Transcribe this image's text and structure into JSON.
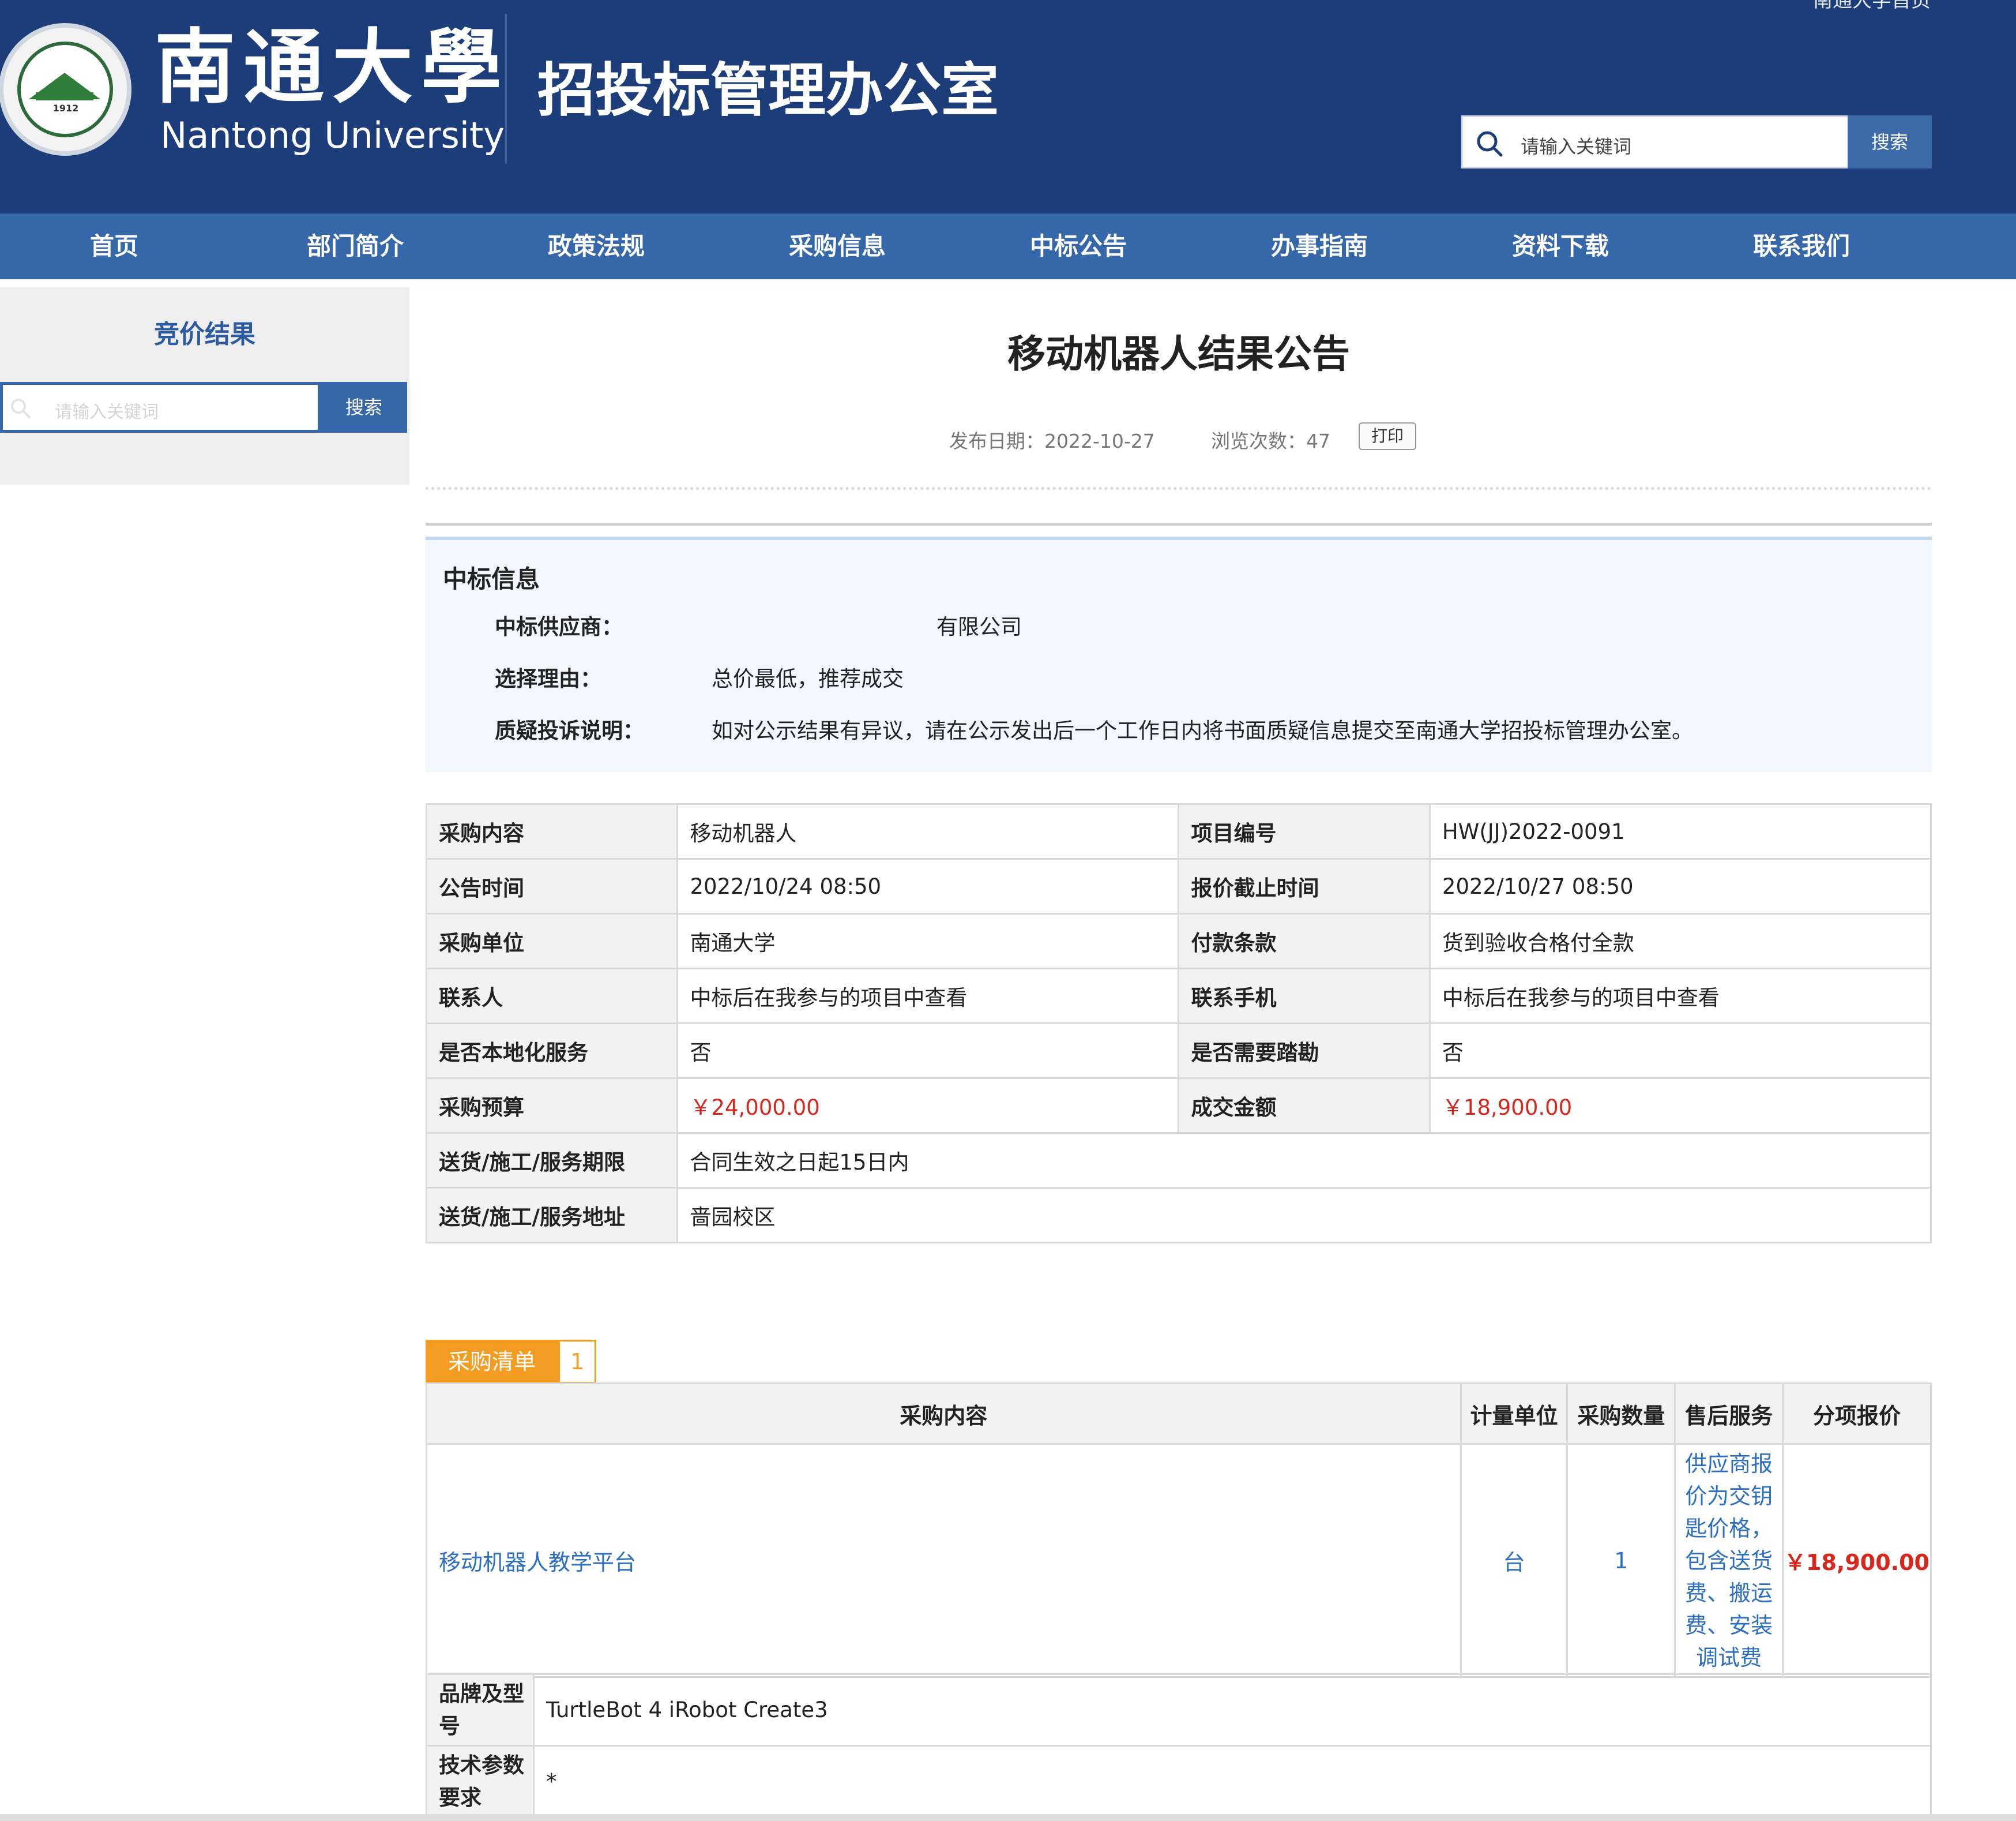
{
  "header": {
    "home_link": "南通大学首页",
    "brand_cn": "南通大學",
    "brand_en": "Nantong University",
    "seal_year": "1912",
    "office_title": "招投标管理办公室",
    "search_placeholder": "请输入关键词",
    "search_button": "搜索",
    "colors": {
      "header_bg": "#1c3d7a",
      "nav_bg": "#3567a9"
    }
  },
  "nav": {
    "items": [
      "首页",
      "部门简介",
      "政策法规",
      "采购信息",
      "中标公告",
      "办事指南",
      "资料下载",
      "联系我们"
    ]
  },
  "sidebar": {
    "title": "竞价结果",
    "search_placeholder": "请输入关键词",
    "search_button": "搜索"
  },
  "article": {
    "title": "移动机器人结果公告",
    "publish_date": "发布日期：2022-10-27",
    "views": "浏览次数：47",
    "print_button": "打印"
  },
  "bid_info": {
    "heading": "中标信息",
    "rows": [
      {
        "label": "中标供应商：",
        "value": "有限公司"
      },
      {
        "label": "选择理由：",
        "value": "总价最低，推荐成交"
      },
      {
        "label": "质疑投诉说明：",
        "value": "如对公示结果有异议，请在公示发出后一个工作日内将书面质疑信息提交至南通大学招投标管理办公室。"
      }
    ]
  },
  "details": {
    "rows": [
      {
        "k1": "采购内容",
        "v1": "移动机器人",
        "k2": "项目编号",
        "v2": "HW(JJ)2022-0091"
      },
      {
        "k1": "公告时间",
        "v1": "2022/10/24 08:50",
        "k2": "报价截止时间",
        "v2": "2022/10/27 08:50"
      },
      {
        "k1": "采购单位",
        "v1": "南通大学",
        "k2": "付款条款",
        "v2": "货到验收合格付全款"
      },
      {
        "k1": "联系人",
        "v1": "中标后在我参与的项目中查看",
        "k2": "联系手机",
        "v2": "中标后在我参与的项目中查看"
      },
      {
        "k1": "是否本地化服务",
        "v1": "否",
        "k2": "是否需要踏勘",
        "v2": "否"
      },
      {
        "k1": "采购预算",
        "v1": "￥24,000.00",
        "k2": "成交金额",
        "v2": "￥18,900.00"
      }
    ],
    "wide_rows": [
      {
        "k": "送货/施工/服务期限",
        "v": "合同生效之日起15日内"
      },
      {
        "k": "送货/施工/服务地址",
        "v": "啬园校区"
      }
    ],
    "highlight_color": "#d9261c"
  },
  "purchase_list": {
    "tab_label": "采购清单",
    "tab_count": "1",
    "headers": [
      "采购内容",
      "计量单位",
      "采购数量",
      "售后服务",
      "分项报价"
    ],
    "item": {
      "name": "移动机器人教学平台",
      "unit": "台",
      "quantity": "1",
      "service_lines": [
        "供应商报",
        "价为交钥",
        "匙价格，",
        "包含送货",
        "费、搬运",
        "费、安装",
        "调试费"
      ],
      "price": "￥18,900.00"
    },
    "brand_label_lines": [
      "品牌及型",
      "号"
    ],
    "brand_value": "TurtleBot 4 iRobot Create3",
    "spec_label_lines": [
      "技术参数",
      "要求"
    ],
    "spec_value": "*",
    "tab_color": "#f39c22"
  }
}
